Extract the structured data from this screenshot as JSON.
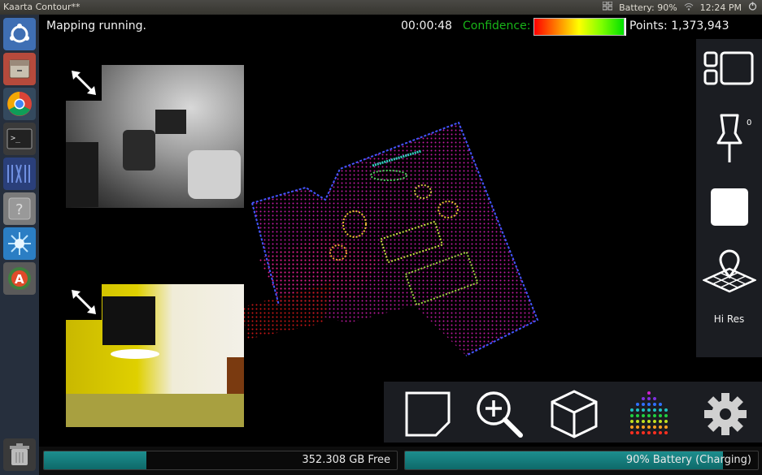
{
  "window": {
    "title": "Kaarta Contour**"
  },
  "tray": {
    "battery": "Battery: 90%",
    "time": "12:24 PM"
  },
  "launcher": {
    "items": [
      "ubuntu-dash",
      "files",
      "chrome",
      "terminal",
      "kaarta-logo",
      "help",
      "spark",
      "software-updater",
      "trash"
    ]
  },
  "header": {
    "status": "Mapping running.",
    "timer": "00:00:48",
    "confidence_label": "Confidence:",
    "points": "Points: 1,373,943"
  },
  "cameras": [
    {
      "name": "top-camera",
      "style": "grayscale"
    },
    {
      "name": "bottom-camera",
      "style": "yellow"
    }
  ],
  "right_panel": {
    "pin_count": "0",
    "hires_label": "Hi Res",
    "icons": [
      "layout-icon",
      "pin-icon",
      "stop-icon",
      "map-location-icon"
    ]
  },
  "toolbar": {
    "icons": [
      "crop-icon",
      "zoom-in-icon",
      "cube-icon",
      "color-points-icon",
      "settings-icon"
    ]
  },
  "storage": {
    "free": "352.308 GB Free",
    "used_fraction": 0.29
  },
  "battery": {
    "label": "90% Battery (Charging)",
    "level": 0.9
  },
  "colors": {
    "confidence_label": "#18b418",
    "bar_fill": "#168080",
    "panel": "#1b1d22"
  }
}
